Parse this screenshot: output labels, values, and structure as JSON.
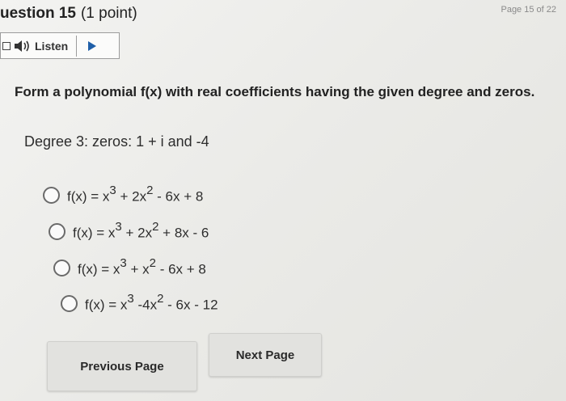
{
  "page_indicator": "Page 15 of 22",
  "question": {
    "title": "uestion 15",
    "points": "(1 point)"
  },
  "listen": {
    "label": "Listen",
    "icons": [
      "grid-icon",
      "speaker-icon",
      "play-icon"
    ]
  },
  "instruction": "Form a polynomial f(x) with real coefficients having the given degree and zeros.",
  "degree_line": "Degree 3: zeros: 1 + i and -4",
  "options": [
    {
      "prefix": "f(x) = x",
      "exp1": "3",
      "mid": " + 2x",
      "exp2": "2",
      "rest": " - 6x + 8"
    },
    {
      "prefix": "f(x) = x",
      "exp1": "3",
      "mid": " + 2x",
      "exp2": "2",
      "rest": " + 8x - 6"
    },
    {
      "prefix": "f(x) = x",
      "exp1": "3",
      "mid": " + x",
      "exp2": "2",
      "rest": " - 6x + 8"
    },
    {
      "prefix": "f(x) = x",
      "exp1": "3",
      "mid": " -4x",
      "exp2": "2",
      "rest": " - 6x - 12"
    }
  ],
  "nav": {
    "previous_label": "Previous Page",
    "next_label": "Next Page"
  }
}
